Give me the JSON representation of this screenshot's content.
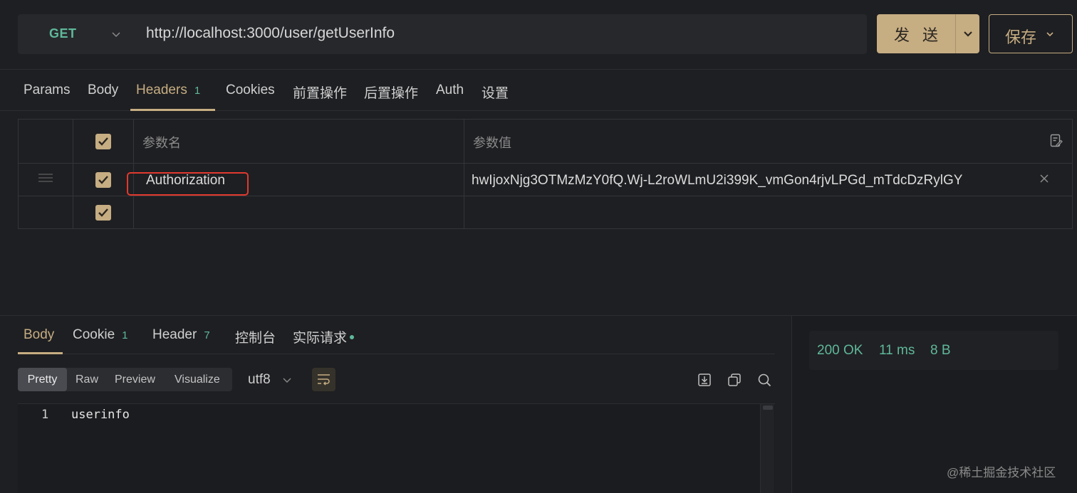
{
  "request": {
    "method": "GET",
    "url": "http://localhost:3000/user/getUserInfo",
    "send_label": "发 送",
    "save_label": "保存"
  },
  "request_tabs": [
    {
      "label": "Params"
    },
    {
      "label": "Body"
    },
    {
      "label": "Headers",
      "count": "1",
      "active": true
    },
    {
      "label": "Cookies"
    },
    {
      "label": "前置操作"
    },
    {
      "label": "后置操作"
    },
    {
      "label": "Auth"
    },
    {
      "label": "设置"
    }
  ],
  "headers_table": {
    "columns": [
      "参数名",
      "参数值"
    ],
    "rows": [
      {
        "checked": true,
        "name": "Authorization",
        "value": "hwIjoxNjg3OTMzMzY0fQ.Wj-L2roWLmU2i399K_vmGon4rjvLPGd_mTdcDzRylGY"
      },
      {
        "checked": true,
        "name": "",
        "value": ""
      }
    ]
  },
  "response_tabs": [
    {
      "label": "Body",
      "active": true
    },
    {
      "label": "Cookie",
      "count": "1"
    },
    {
      "label": "Header",
      "count": "7"
    },
    {
      "label": "控制台"
    },
    {
      "label": "实际请求",
      "dot": true
    }
  ],
  "view_modes": [
    "Pretty",
    "Raw",
    "Preview",
    "Visualize"
  ],
  "active_view_mode": "Pretty",
  "encoding": "utf8",
  "body": {
    "lines": [
      {
        "number": "1",
        "text": "userinfo"
      }
    ]
  },
  "status": {
    "code": "200 OK",
    "time": "11 ms",
    "size": "8 B"
  },
  "watermark": "@稀土掘金技术社区",
  "colors": {
    "accent": "#c6ad82",
    "method_green": "#5fb89a",
    "highlight_red": "#e1392f",
    "background": "#1e1f22"
  },
  "icons": [
    "chevron-down-icon",
    "drag-handle-icon",
    "checkbox-icon",
    "edit-icon",
    "close-icon",
    "wrap-icon",
    "download-icon",
    "copy-icon",
    "search-icon"
  ]
}
